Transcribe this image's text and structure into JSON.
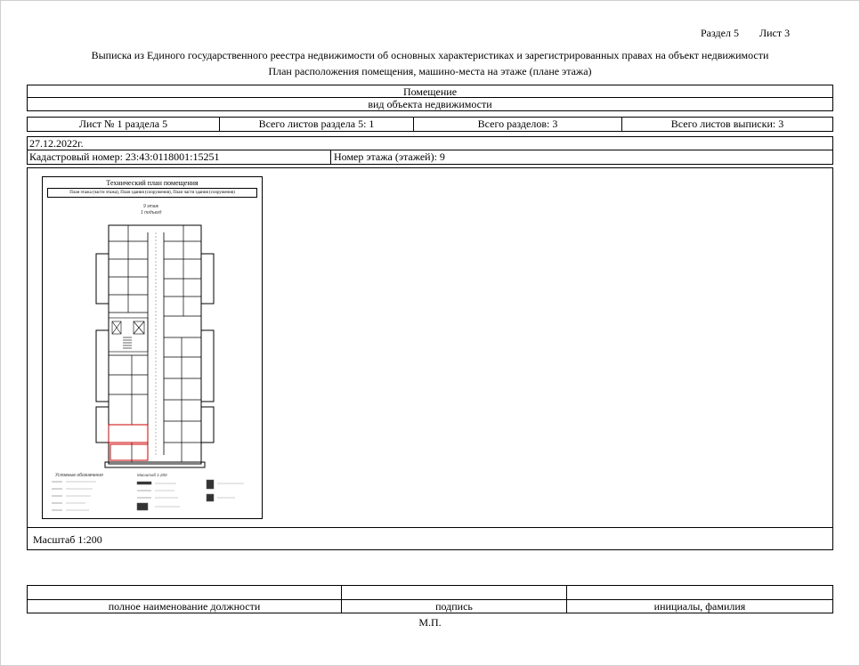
{
  "header": {
    "section": "Раздел 5",
    "sheet": "Лист 3"
  },
  "title": {
    "line1": "Выписка из Единого государственного реестра недвижимости об основных характеристиках и зарегистрированных правах на объект недвижимости",
    "line2": "План расположения помещения, машино-места на этаже (плане этажа)"
  },
  "object": {
    "value": "Помещение",
    "caption": "вид объекта недвижимости"
  },
  "sheets": {
    "sheet_no": "Лист № 1 раздела 5",
    "total_sheets_section": "Всего листов раздела 5: 1",
    "total_sections": "Всего разделов: 3",
    "total_sheets_extract": "Всего листов выписки: 3"
  },
  "date": "27.12.2022г.",
  "cadastral": {
    "number": "Кадастровый номер: 23:43:0118001:15251",
    "floor": "Номер этажа (этажей): 9"
  },
  "plan": {
    "title": "Технический план помещения",
    "subtitle": "План этажа (части этажа), План здания (сооружения), План части здания (сооружения)",
    "floor_label": "9 этаж",
    "floor_sub": "1 подъезд",
    "legend_title": "Условные обозначения",
    "scale_note": "Масштаб 1:200"
  },
  "scale": "Масштаб 1:200",
  "signature": {
    "position_caption": "полное наименование должности",
    "sign_caption": "подпись",
    "name_caption": "инициалы, фамилия"
  },
  "stamp": "М.П."
}
